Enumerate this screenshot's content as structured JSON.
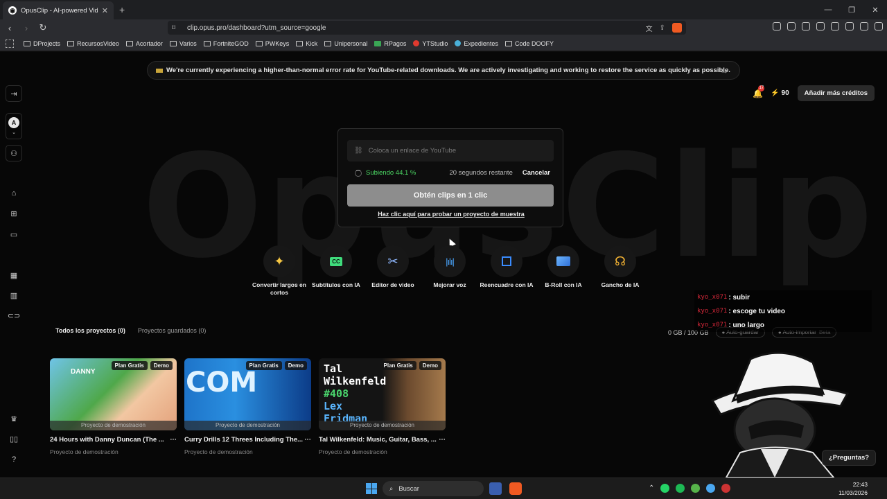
{
  "browser": {
    "tab_title": "OpusClip - AI-powered Video Re",
    "url": "clip.opus.pro/dashboard?utm_source=google",
    "bookmarks": [
      "DProjects",
      "RecursosVideo",
      "Acortador",
      "Varios",
      "FortniteGOD",
      "PWKeys",
      "Kick",
      "Unipersonal",
      "RPagos",
      "YTStudio",
      "Expedientes",
      "Code DOOFY"
    ]
  },
  "banner": {
    "text": "We're currently experiencing a higher-than-normal error rate for YouTube-related downloads. We are actively investigating and working to restore the service as quickly as possible."
  },
  "header": {
    "notifications": "17",
    "credits": "90",
    "add_credits": "Añadir más créditos"
  },
  "watermark": "OpusClip",
  "upload": {
    "placeholder": "Coloca un enlace de YouTube",
    "status": "Subiendo 44.1 %",
    "remaining": "20 segundos restante",
    "cancel": "Cancelar",
    "primary": "Obtén clips en 1 clic",
    "sample_link": "Haz clic aquí para probar un proyecto de muestra"
  },
  "tools": [
    {
      "label": "Convertir largos en cortos",
      "icon": "sparkle-icon",
      "color": "#f6c743"
    },
    {
      "label": "Subtítulos con IA",
      "icon": "captions-icon",
      "color": "#3fdc7c"
    },
    {
      "label": "Editor de video",
      "icon": "scissors-icon",
      "color": "#8fb8ff"
    },
    {
      "label": "Mejorar voz",
      "icon": "waveform-icon",
      "color": "#4aa7ff"
    },
    {
      "label": "Reencuadre con IA",
      "icon": "crop-icon",
      "color": "#3a8cff"
    },
    {
      "label": "B-Roll con IA",
      "icon": "broll-icon",
      "color": "#6db7ff"
    },
    {
      "label": "Gancho de IA",
      "icon": "hook-icon",
      "color": "#f2b233"
    }
  ],
  "projects_section": {
    "tab_all": "Todos los proyectos (0)",
    "tab_saved": "Proyectos guardados (0)",
    "storage": "0 GB / 100 GB",
    "auto_save": "Auto-guardar",
    "auto_import": "Auto-importar",
    "beta": "Beta"
  },
  "projects": [
    {
      "title": "24 Hours with Danny Duncan (The ...",
      "subtitle": "Proyecto de demostración",
      "badge_plan": "Plan Gratis",
      "badge_demo": "Demo",
      "footer": "Proyecto de demostración",
      "thumb_text": "DANNY"
    },
    {
      "title": "Curry Drills 12 Threes Including The...",
      "subtitle": "Proyecto de demostración",
      "badge_plan": "Plan Gratis",
      "badge_demo": "Demo",
      "footer": "Proyecto de demostración",
      "thumb_text": "COM"
    },
    {
      "title": "Tal Wilkenfeld: Music, Guitar, Bass, ...",
      "subtitle": "Proyecto de demostración",
      "badge_plan": "Plan Gratis",
      "badge_demo": "Demo",
      "footer": "Proyecto de demostración",
      "thumb_text": [
        "Tal",
        "Wilkenfeld",
        "#408",
        "Lex",
        "Fridman"
      ]
    }
  ],
  "chat": [
    {
      "user": "kyo_x071",
      "msg": ": subir"
    },
    {
      "user": "kyo_x071",
      "msg": ": escoge tu video"
    },
    {
      "user": "kyo_x071",
      "msg": ": uno largo"
    }
  ],
  "help": "¿Preguntas?",
  "taskbar": {
    "search": "Buscar",
    "time": "22:43",
    "date": "11/03/2026"
  }
}
